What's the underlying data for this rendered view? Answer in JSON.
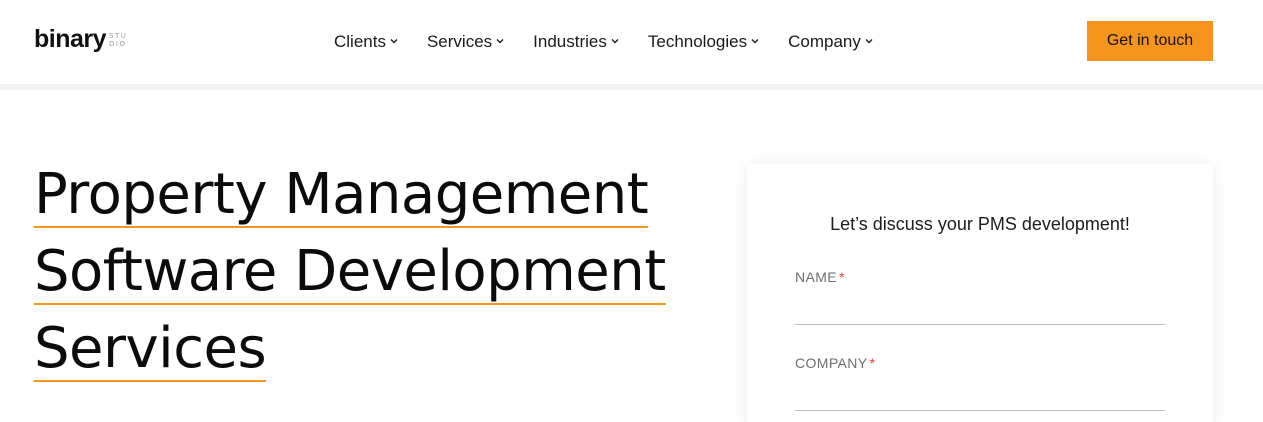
{
  "header": {
    "logo": {
      "main": "binary",
      "sub_top": "STU",
      "sub_bottom": "DIO"
    },
    "nav": [
      {
        "label": "Clients"
      },
      {
        "label": "Services"
      },
      {
        "label": "Industries"
      },
      {
        "label": "Technologies"
      },
      {
        "label": "Company"
      }
    ],
    "cta_label": "Get in touch"
  },
  "hero": {
    "title_lines": [
      "Property Management",
      "Software Development",
      "Services"
    ]
  },
  "form": {
    "heading": "Let’s discuss your PMS development!",
    "fields": [
      {
        "label": "NAME",
        "required_mark": "*",
        "value": "",
        "placeholder": ""
      },
      {
        "label": "COMPANY",
        "required_mark": "*",
        "value": "",
        "placeholder": ""
      }
    ]
  },
  "colors": {
    "accent": "#f7941d",
    "required": "#e23b3b",
    "text": "#111111"
  },
  "icons": {
    "nav_dropdown": "chevron-down-icon"
  }
}
